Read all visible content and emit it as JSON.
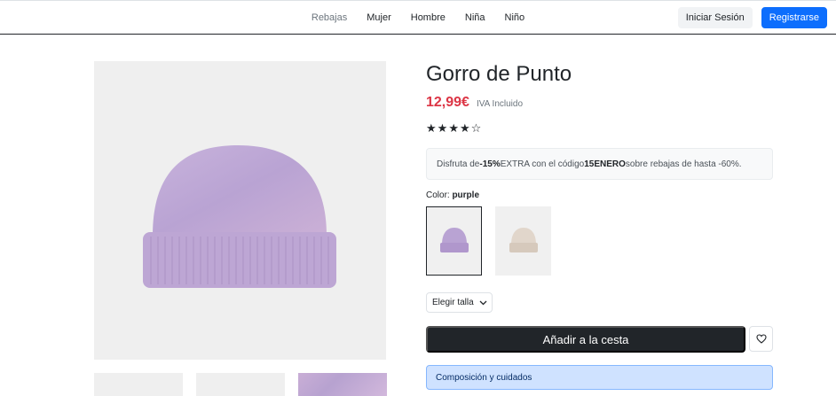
{
  "nav": {
    "links": [
      "Rebajas",
      "Mujer",
      "Hombre",
      "Niña",
      "Niño"
    ],
    "login_label": "Iniciar Sesión",
    "register_label": "Registrarse"
  },
  "product": {
    "title": "Gorro de Punto",
    "price": "12,99€",
    "tax_note": "IVA Incluido",
    "rating": 4,
    "rating_max": 5,
    "promo": {
      "prefix": "Disfruta de ",
      "discount": "-15%",
      "middle": " EXTRA con el código ",
      "code": "15ENERO",
      "suffix": " sobre rebajas de hasta -60%."
    },
    "color_label": "Color: ",
    "color_value": "purple",
    "colors": [
      {
        "name": "purple",
        "selected": true,
        "hex": "#b9a3d3"
      },
      {
        "name": "beige",
        "selected": false,
        "hex": "#e1d6cb"
      }
    ],
    "size_select_label": "Elegir talla",
    "add_to_cart_label": "Añadir a la cesta",
    "accordion_label": "Composición y cuidados"
  },
  "colors": {
    "accent": "#0d6efd",
    "price": "#dc3545",
    "dark": "#212529"
  }
}
